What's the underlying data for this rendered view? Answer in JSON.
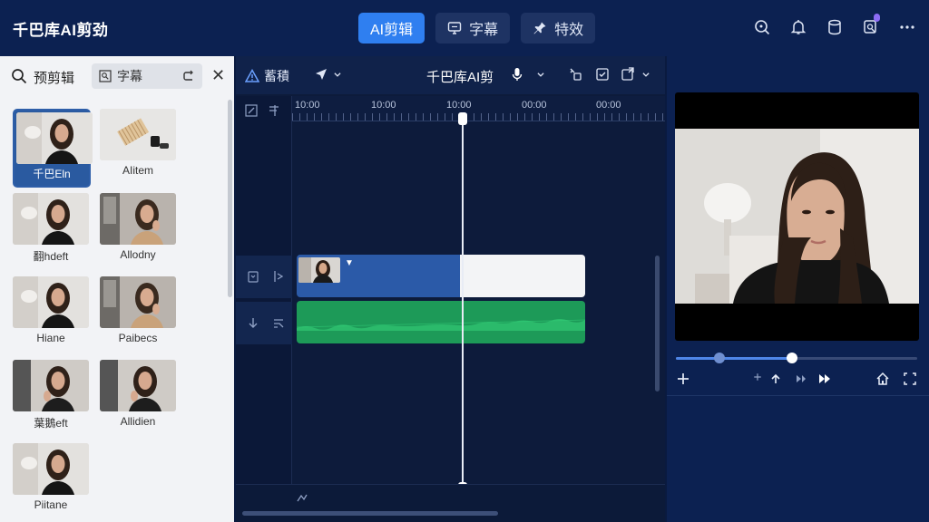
{
  "app": {
    "title": "千巴库AI剪劲"
  },
  "top_tabs": [
    {
      "label": "AI剪辑",
      "icon": "",
      "active": true
    },
    {
      "label": "字幕",
      "icon": "monitor-icon",
      "active": false
    },
    {
      "label": "特效",
      "icon": "pin-icon",
      "active": false
    }
  ],
  "top_icons": [
    "search-icon",
    "bell-icon",
    "database-icon",
    "share-icon",
    "more-icon"
  ],
  "left_panel": {
    "title": "预剪辑",
    "chip_label": "字幕",
    "close": "✕",
    "items": [
      {
        "label": "千巴Eln",
        "selected": true,
        "kind": "woman"
      },
      {
        "label": "AIitem",
        "selected": false,
        "kind": "object"
      },
      {
        "label": "翻hdeft",
        "selected": false,
        "kind": "woman"
      },
      {
        "label": "Allodny",
        "selected": false,
        "kind": "woman-window"
      },
      {
        "label": "Hiane",
        "selected": false,
        "kind": "woman"
      },
      {
        "label": "Paibecs",
        "selected": false,
        "kind": "woman-window"
      },
      {
        "label": "葉鵝eft",
        "selected": false,
        "kind": "woman-dark"
      },
      {
        "label": "Allidien",
        "selected": false,
        "kind": "woman-dark"
      },
      {
        "label": "Piitane",
        "selected": false,
        "kind": "woman"
      }
    ]
  },
  "timeline": {
    "title": "千巴库AI剪",
    "toolbar_left_label": "蓄積",
    "ruler_labels": [
      "10:00",
      "10:00",
      "10:00",
      "00:00",
      "00:00"
    ],
    "accent_colors": {
      "video": "#2b5aa8",
      "audio": "#1d9a58",
      "playhead": "#e8ecf5"
    }
  },
  "preview": {
    "progress": 0.48,
    "buffered": 0.18
  }
}
